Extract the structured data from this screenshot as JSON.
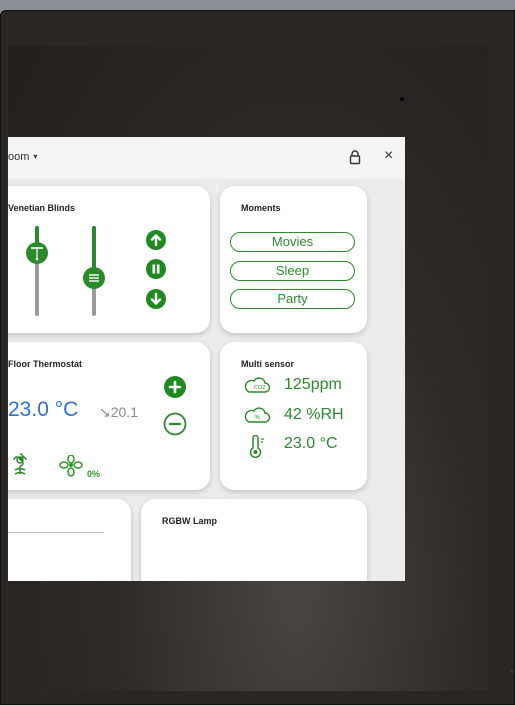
{
  "header": {
    "room_label": "oom",
    "caret": "▾",
    "lock_icon": "lock-icon",
    "close_label": "×"
  },
  "blinds": {
    "title": "Venetian Blinds",
    "slat_position_level": 0.18,
    "lift_position_level": 0.45,
    "up_icon": "arrow-up-icon",
    "pause_icon": "pause-icon",
    "down_icon": "arrow-down-icon"
  },
  "moments": {
    "title": "Moments",
    "items": [
      "Movies",
      "Sleep",
      "Party"
    ]
  },
  "thermostat": {
    "title": "Floor Thermostat",
    "temperature": "23.0 °C",
    "setpoint": "↘20.1",
    "fan_percent": "0%",
    "plus_icon": "plus-icon",
    "minus_icon": "minus-icon"
  },
  "multisensor": {
    "title": "Multi sensor",
    "rows": [
      {
        "icon": "co2-cloud-icon",
        "value": "125ppm"
      },
      {
        "icon": "humidity-cloud-icon",
        "value": "42 %RH"
      },
      {
        "icon": "thermometer-icon",
        "value": "23.0 °C"
      }
    ]
  },
  "rgbw": {
    "title": "RGBW Lamp"
  },
  "colors": {
    "accent_green": "#2c8a2c",
    "temperature_blue": "#2f6fd0",
    "app_background": "#ececec",
    "card_background": "#ffffff"
  }
}
